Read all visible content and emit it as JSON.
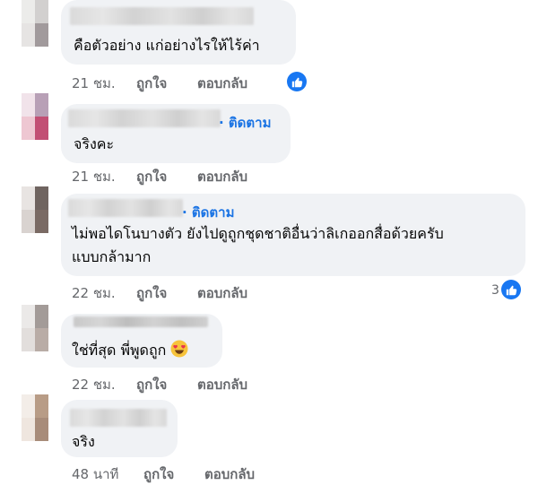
{
  "comments": [
    {
      "text": "คือตัวอย่าง แก่อย่างไรให้ไร้ค่า",
      "time": "21 ชม.",
      "like": "ถูกใจ",
      "reply": "ตอบกลับ"
    },
    {
      "follow": "· ติดตาม",
      "text": "จริงคะ",
      "time": "21 ชม.",
      "like": "ถูกใจ",
      "reply": "ตอบกลับ"
    },
    {
      "follow": "· ติดตาม",
      "text_line1": "ไม่พอไดโนบางตัว ยังไปดูถูกชุดชาติอื่นว่าลิเกออกสื่อด้วยครับ",
      "text_line2": "แบบกล้ามาก",
      "time": "22 ชม.",
      "like": "ถูกใจ",
      "reply": "ตอบกลับ",
      "reaction_count": "3"
    },
    {
      "text": "ใช่ที่สุด พี่พูดถูก",
      "emoji": "heart-eyes-emoji",
      "time": "22 ชม.",
      "like": "ถูกใจ",
      "reply": "ตอบกลับ"
    },
    {
      "text": "จริง",
      "time": "48 นาที",
      "like": "ถูกใจ",
      "reply": "ตอบกลับ"
    }
  ],
  "colors": {
    "bubble": "#f0f2f5",
    "meta": "#65676b",
    "link": "#1b74e4",
    "like_blue": "#1877f2"
  }
}
